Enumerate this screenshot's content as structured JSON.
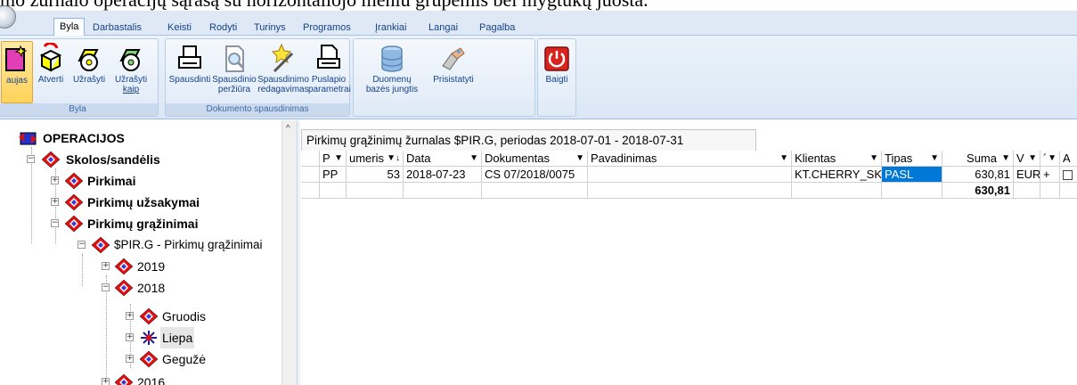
{
  "caption": "mo žurnalo operacijų sąrašą su horizontaliojo meniu grupėmis bei mygtukų juosta.",
  "menu_tabs": [
    "Byla",
    "Darbastalis",
    "Keisti",
    "Rodyti",
    "Turinys",
    "Programos",
    "Įrankiai",
    "Langai",
    "Pagalba"
  ],
  "ribbon": {
    "groups": [
      {
        "label": "Byla",
        "buttons": [
          {
            "line1": "aujas",
            "line2": "",
            "icon": "new-file-icon"
          },
          {
            "line1": "Atverti",
            "line2": "",
            "icon": "open-icon"
          },
          {
            "line1": "Užrašyti",
            "line2": "",
            "icon": "save-icon"
          },
          {
            "line1": "Užrašyti",
            "line2": "kaip",
            "icon": "save-as-icon"
          }
        ]
      },
      {
        "label": "Dokumento spausdinimas",
        "buttons": [
          {
            "line1": "Spausdinti",
            "line2": "",
            "icon": "printer-icon"
          },
          {
            "line1": "Spausdinio",
            "line2": "peržiūra",
            "icon": "print-preview-icon"
          },
          {
            "line1": "Spausdinimo",
            "line2": "redagavimas",
            "icon": "print-edit-icon"
          },
          {
            "line1": "Puslapio",
            "line2": "parametrai",
            "icon": "page-setup-icon"
          }
        ]
      },
      {
        "label": "",
        "buttons": [
          {
            "line1": "Duomenų",
            "line2": "bazės jungtis",
            "icon": "database-icon"
          },
          {
            "line1": "Prisistatyti",
            "line2": "",
            "icon": "login-icon"
          }
        ]
      },
      {
        "label": "",
        "buttons": [
          {
            "line1": "Baigti",
            "line2": "",
            "icon": "power-icon"
          }
        ]
      }
    ]
  },
  "tree": {
    "root": "OPERACIJOS",
    "skolos": "Skolos/sandėlis",
    "pirkimai": "Pirkimai",
    "uzsakymai": "Pirkimų užsakymai",
    "grazinimai": "Pirkimų grąžinimai",
    "pirg": "$PIR.G - Pirkimų grąžinimai",
    "y2019": "2019",
    "y2018": "2018",
    "gruodis": "Gruodis",
    "liepa": "Liepa",
    "geguze": "Gegužė",
    "y2016": "2016"
  },
  "grid": {
    "title": "Pirkimų grąžinimų žurnalas $PIR.G, periodas 2018-07-01 - 2018-07-31",
    "headers": [
      "P",
      "umeris",
      "Data",
      "Dokumentas",
      "Pavadinimas",
      "Klientas",
      "Tipas",
      "Suma",
      "V",
      "´",
      "A"
    ],
    "row": {
      "p": "PP",
      "numeris": "53",
      "data": "2018-07-23",
      "dokumentas": "CS  07/2018/0075",
      "pavadinimas": "",
      "klientas": "KT.CHERRY_SKAIČIUOTUVAS",
      "tipas": "PASL",
      "suma": "630,81",
      "valiuta": "EUR",
      "plus": "+"
    },
    "total": "630,81"
  }
}
